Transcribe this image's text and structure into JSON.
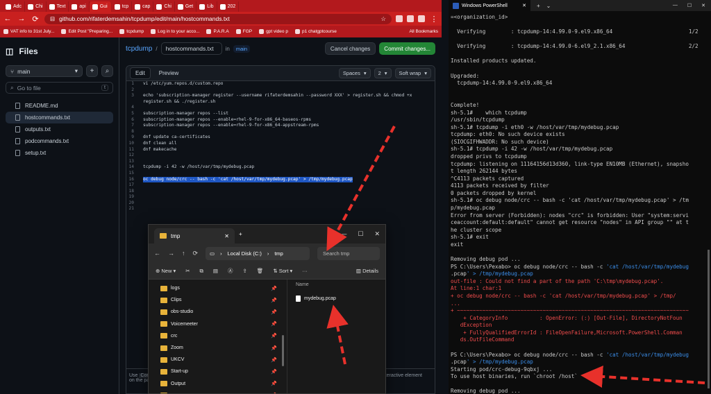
{
  "browser": {
    "tabs": [
      "Adc",
      "Chi",
      "Text",
      "api",
      "Gui",
      "tcp",
      "cap",
      "Chi",
      "Get",
      "Lib",
      "202"
    ],
    "url": "github.com/rifaterdemsahin/tcpdump/edit/main/hostcommands.txt",
    "bookmarks": [
      "VAT info to 31st July...",
      "Edit Post \"Preparing...",
      "tcpdump",
      "Log in to your acco...",
      "P.A.R.A",
      "FGP",
      "gpt video p",
      "p1 chatgptcourse"
    ],
    "all_bookmarks": "All Bookmarks"
  },
  "sidebar": {
    "title": "Files",
    "branch": "main",
    "goto_placeholder": "Go to file",
    "goto_kbd": "t",
    "files": [
      "README.md",
      "hostcommands.txt",
      "outputs.txt",
      "podcommands.txt",
      "setup.txt"
    ]
  },
  "editor": {
    "repo": "tcpdump",
    "sep": "/",
    "filename": "hostcommands.txt",
    "in_label": "in",
    "branch": "main",
    "cancel_label": "Cancel changes",
    "commit_label": "Commit changes...",
    "tab_edit": "Edit",
    "tab_preview": "Preview",
    "indent_mode": "Spaces",
    "indent_size": "2",
    "wrap_mode": "Soft wrap",
    "hint_left": "Use",
    "hint_code": "Cont",
    "hint_left2": "on the pa",
    "hint_right": "interactive element",
    "lines": [
      {
        "n": "1",
        "t": "vi /etc/yum.repos.d/custom.repo",
        "h": false
      },
      {
        "n": "2",
        "t": "",
        "h": false
      },
      {
        "n": "3",
        "t": "echo 'subscription-manager register --username rifaterdemsahin --password XXX' > register.sh && chmod +x",
        "h": false
      },
      {
        "n": "",
        "t": "register.sh && ./register.sh",
        "h": false
      },
      {
        "n": "4",
        "t": "",
        "h": false
      },
      {
        "n": "5",
        "t": "subscription-manager repos --list",
        "h": false
      },
      {
        "n": "6",
        "t": "subscription-manager repos --enable=rhel-9-for-x86_64-baseos-rpms",
        "h": false
      },
      {
        "n": "7",
        "t": "subscription-manager repos --enable=rhel-9-for-x86_64-appstream-rpms",
        "h": false
      },
      {
        "n": "8",
        "t": "",
        "h": false
      },
      {
        "n": "9",
        "t": "dnf update ca-certificates",
        "h": false
      },
      {
        "n": "10",
        "t": "dnf clean all",
        "h": false
      },
      {
        "n": "11",
        "t": "dnf makecache",
        "h": false
      },
      {
        "n": "12",
        "t": "",
        "h": false
      },
      {
        "n": "13",
        "t": "",
        "h": false
      },
      {
        "n": "14",
        "t": "tcpdump -i 42 -w /host/var/tmp/mydebug.pcap",
        "h": false
      },
      {
        "n": "15",
        "t": "",
        "h": false
      },
      {
        "n": "16",
        "t": "oc debug node/crc -- bash -c 'cat /host/var/tmp/mydebug.pcap' > /tmp/mydebug.pcap",
        "h": true
      },
      {
        "n": "17",
        "t": "",
        "h": false
      },
      {
        "n": "18",
        "t": "",
        "h": false
      },
      {
        "n": "19",
        "t": "",
        "h": false
      },
      {
        "n": "20",
        "t": "",
        "h": false
      },
      {
        "n": "21",
        "t": "",
        "h": false
      }
    ]
  },
  "explorer": {
    "tab_title": "tmp",
    "path_root": "Local Disk (C:)",
    "path_leaf": "tmp",
    "search_placeholder": "Search tmp",
    "new_label": "New",
    "sort_label": "Sort",
    "details_label": "Details",
    "col_name": "Name",
    "nav_items": [
      "logs",
      "Clips",
      "obs-studio",
      "Voicemeeter",
      "crc",
      "Zoom",
      "UKCV",
      "Start-up",
      "Output",
      "info@pexabo.com"
    ],
    "files": [
      "mydebug.pcap"
    ]
  },
  "powershell": {
    "tab_title": "Windows PowerShell",
    "lines": [
      {
        "t": "=<organization_id>",
        "c": ""
      },
      {
        "t": "",
        "c": ""
      },
      {
        "t": "  Verifying        : tcpdump-14:4.99.0-9.el9.x86_64                        1/2",
        "c": ""
      },
      {
        "t": "",
        "c": ""
      },
      {
        "t": "  Verifying        : tcpdump-14:4.99.0-6.el9_2.1.x86_64                    2/2",
        "c": ""
      },
      {
        "t": "",
        "c": ""
      },
      {
        "t": "Installed products updated.",
        "c": ""
      },
      {
        "t": "",
        "c": ""
      },
      {
        "t": "Upgraded:",
        "c": ""
      },
      {
        "t": "  tcpdump-14:4.99.0-9.el9.x86_64",
        "c": ""
      },
      {
        "t": "",
        "c": ""
      },
      {
        "t": "",
        "c": ""
      },
      {
        "t": "Complete!",
        "c": ""
      },
      {
        "t": "sh-5.1#    which tcpdump",
        "c": ""
      },
      {
        "t": "/usr/sbin/tcpdump",
        "c": ""
      },
      {
        "t": "sh-5.1# tcpdump -i eth0 -w /host/var/tmp/mydebug.pcap",
        "c": ""
      },
      {
        "t": "tcpdump: eth0: No such device exists",
        "c": ""
      },
      {
        "t": "(SIOCGIFHWADDR: No such device)",
        "c": ""
      },
      {
        "t": "sh-5.1# tcpdump -i 42 -w /host/var/tmp/mydebug.pcap",
        "c": ""
      },
      {
        "t": "dropped privs to tcpdump",
        "c": ""
      },
      {
        "t": "tcpdump: listening on 11164156d13d360, link-type EN10MB (Ethernet), snapsho",
        "c": ""
      },
      {
        "t": "t length 262144 bytes",
        "c": ""
      },
      {
        "t": "^C4113 packets captured",
        "c": ""
      },
      {
        "t": "4113 packets received by filter",
        "c": ""
      },
      {
        "t": "0 packets dropped by kernel",
        "c": ""
      },
      {
        "t": "sh-5.1# oc debug node/crc -- bash -c 'cat /host/var/tmp/mydebug.pcap' > /tm",
        "c": ""
      },
      {
        "t": "p/mydebug.pcap",
        "c": ""
      },
      {
        "t": "Error from server (Forbidden): nodes \"crc\" is forbidden: User \"system:servi",
        "c": ""
      },
      {
        "t": "ceaccount:default:default\" cannot get resource \"nodes\" in API group \"\" at t",
        "c": ""
      },
      {
        "t": "he cluster scope",
        "c": ""
      },
      {
        "t": "sh-5.1# exit",
        "c": ""
      },
      {
        "t": "exit",
        "c": ""
      },
      {
        "t": "",
        "c": ""
      },
      {
        "t": "Removing debug pod ...",
        "c": ""
      },
      {
        "t": "PS C:\\Users\\Pexabo> oc debug node/crc -- bash -c 'cat /host/var/tmp/mydebug",
        "c": "ps"
      },
      {
        "t": ".pcap' > /tmp/mydebug.pcap",
        "c": "ps"
      },
      {
        "t": "out-file : Could not find a part of the path 'C:\\tmp\\mydebug.pcap'.",
        "c": "red"
      },
      {
        "t": "At line:1 char:1",
        "c": "red"
      },
      {
        "t": "+ oc debug node/crc -- bash -c 'cat /host/var/tmp/mydebug.pcap' > /tmp/",
        "c": "red"
      },
      {
        "t": "...",
        "c": "red"
      },
      {
        "t": "+ ~~~~~~~~~~~~~~~~~~~~~~~~~~~~~~~~~~~~~~~~~~~~~~~~~~~~~~~~~~~~~~~~~~~~~~~~~",
        "c": "red"
      },
      {
        "t": "    + CategoryInfo          : OpenError: (:) [Out-File], DirectoryNotFoun",
        "c": "red"
      },
      {
        "t": "   dException",
        "c": "red"
      },
      {
        "t": "    + FullyQualifiedErrorId : FileOpenFailure,Microsoft.PowerShell.Comman",
        "c": "red"
      },
      {
        "t": "   ds.OutFileCommand",
        "c": "red"
      },
      {
        "t": "",
        "c": ""
      },
      {
        "t": "PS C:\\Users\\Pexabo> oc debug node/crc -- bash -c 'cat /host/var/tmp/mydebug",
        "c": "ps"
      },
      {
        "t": ".pcap' > /tmp/mydebug.pcap",
        "c": "ps"
      },
      {
        "t": "Starting pod/crc-debug-9qbxj ...",
        "c": ""
      },
      {
        "t": "To use host binaries, run `chroot /host`",
        "c": ""
      },
      {
        "t": "",
        "c": ""
      },
      {
        "t": "Removing debug pod ...",
        "c": ""
      },
      {
        "t": "PS C:\\Users\\Pexabo> |",
        "c": ""
      }
    ]
  },
  "colors": {
    "accent_red": "#c9201f",
    "github_green": "#238636",
    "selection": "#1f57c3",
    "annotation_arrow": "#e8312b"
  }
}
